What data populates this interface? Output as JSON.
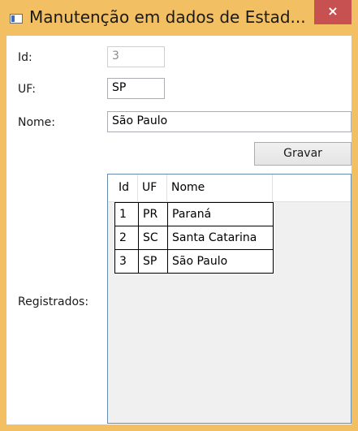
{
  "window": {
    "title": "Manutenção em dados de Estad...",
    "close_glyph": "×",
    "accent": "#f2c062",
    "close_color": "#c75050"
  },
  "form": {
    "id_label": "Id:",
    "id_value": "3",
    "uf_label": "UF:",
    "uf_value": "SP",
    "nome_label": "Nome:",
    "nome_value": "São Paulo",
    "save_label": "Gravar",
    "registrados_label": "Registrados:"
  },
  "table": {
    "columns": [
      "Id",
      "UF",
      "Nome"
    ],
    "rows": [
      [
        "1",
        "PR",
        "Paraná"
      ],
      [
        "2",
        "SC",
        "Santa Catarina"
      ],
      [
        "3",
        "SP",
        "São Paulo"
      ]
    ]
  }
}
